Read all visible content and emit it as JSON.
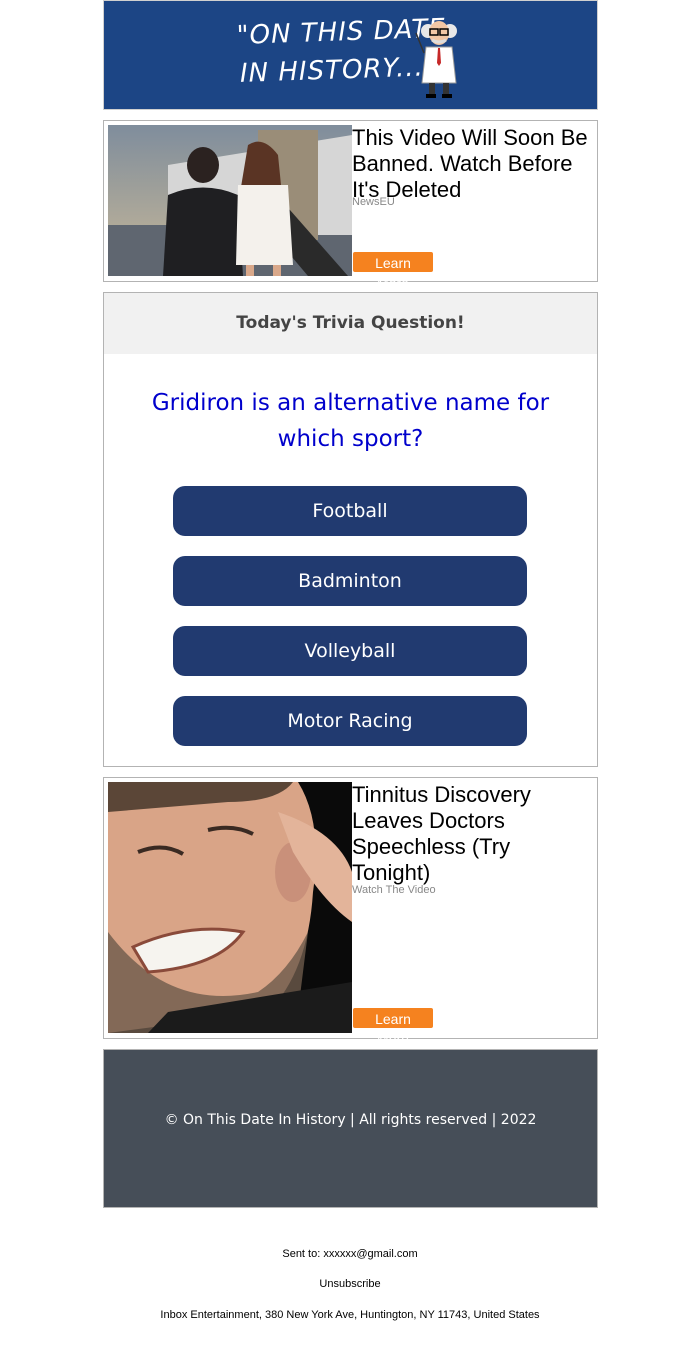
{
  "header": {
    "logo_line1": "\"ON THIS DATE",
    "logo_line2": "IN HISTORY...\"",
    "bg_color": "#1c4585"
  },
  "ads": [
    {
      "title": "This Video Will Soon Be Banned. Watch Before It's Deleted",
      "source": "NewsEU",
      "button": "Learn More",
      "image": "couple-boarding-jet-photo"
    },
    {
      "title": "Tinnitus Discovery Leaves Doctors Speechless (Try Tonight)",
      "source": "Watch The Video",
      "button": "Learn More",
      "image": "man-holding-ear-photo"
    }
  ],
  "trivia": {
    "heading": "Today's Trivia Question!",
    "question": "Gridiron is an alternative name for which sport?",
    "answers": [
      "Football",
      "Badminton",
      "Volleyball",
      "Motor Racing"
    ],
    "question_color": "#0000cc",
    "answer_color": "#213a70"
  },
  "footer": {
    "copyright": "© On This Date In History | All rights reserved | 2022",
    "bg_color": "#464e58"
  },
  "meta": {
    "sent_to": "Sent to: xxxxxx@gmail.com",
    "unsubscribe": "Unsubscribe",
    "address": "Inbox Entertainment, 380 New York Ave, Huntington, NY 11743, United States"
  },
  "accent": "#f5821f"
}
